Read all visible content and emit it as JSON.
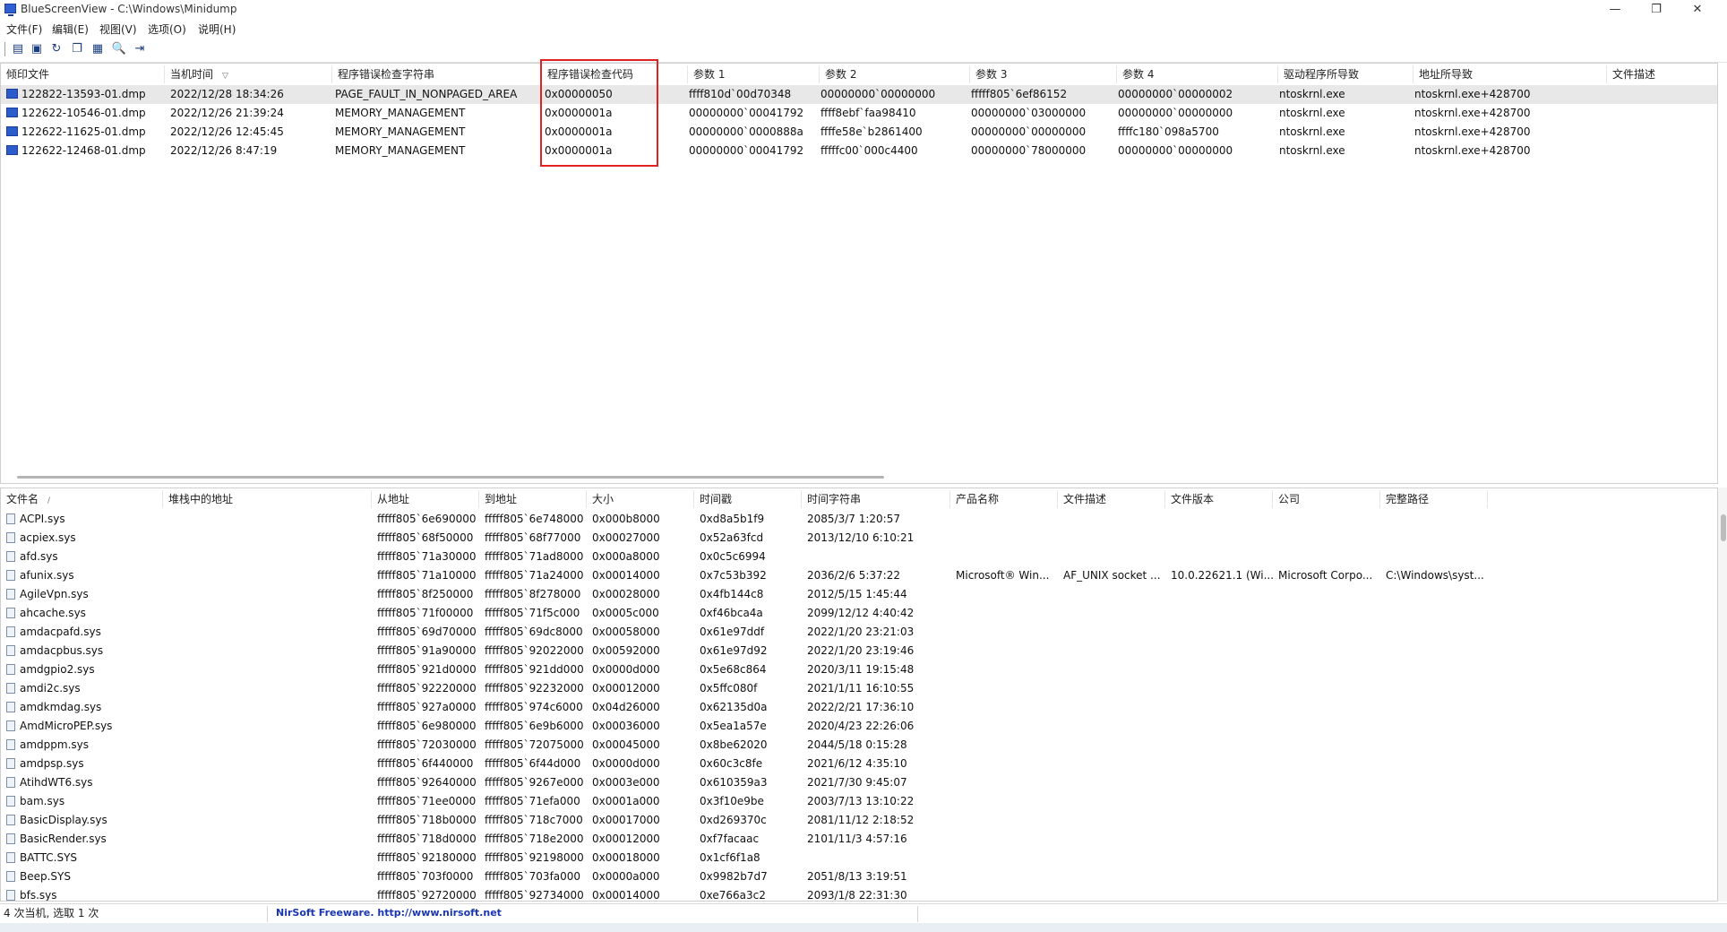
{
  "window": {
    "title": "BlueScreenView  -  C:\\Windows\\Minidump"
  },
  "menu": [
    "文件(F)",
    "编辑(E)",
    "视图(V)",
    "选项(O)",
    "说明(H)"
  ],
  "toolbar": [
    {
      "icon": "properties-icon",
      "glyph": "▤"
    },
    {
      "icon": "save-icon",
      "glyph": "▣"
    },
    {
      "icon": "refresh-icon",
      "glyph": "↻"
    },
    {
      "icon": "copy-icon",
      "glyph": "❐"
    },
    {
      "icon": "report-icon",
      "glyph": "▦"
    },
    {
      "icon": "find-icon",
      "glyph": "🔍"
    },
    {
      "icon": "exit-icon",
      "glyph": "⇥"
    }
  ],
  "top_table": {
    "headers": [
      "倾印文件",
      "当机时间",
      "程序错误检查字符串",
      "程序错误检查代码",
      "参数 1",
      "参数 2",
      "参数 3",
      "参数 4",
      "驱动程序所导致",
      "地址所导致",
      "文件描述"
    ],
    "sort_arrow": "▽",
    "rows": [
      [
        "122822-13593-01.dmp",
        "2022/12/28 18:34:26",
        "PAGE_FAULT_IN_NONPAGED_AREA",
        "0x00000050",
        "ffff810d`00d70348",
        "00000000`00000000",
        "fffff805`6ef86152",
        "00000000`00000002",
        "ntoskrnl.exe",
        "ntoskrnl.exe+428700"
      ],
      [
        "122622-10546-01.dmp",
        "2022/12/26 21:39:24",
        "MEMORY_MANAGEMENT",
        "0x0000001a",
        "00000000`00041792",
        "ffff8ebf`faa98410",
        "00000000`03000000",
        "00000000`00000000",
        "ntoskrnl.exe",
        "ntoskrnl.exe+428700"
      ],
      [
        "122622-11625-01.dmp",
        "2022/12/26 12:45:45",
        "MEMORY_MANAGEMENT",
        "0x0000001a",
        "00000000`0000888a",
        "ffffe58e`b2861400",
        "00000000`00000000",
        "ffffc180`098a5700",
        "ntoskrnl.exe",
        "ntoskrnl.exe+428700"
      ],
      [
        "122622-12468-01.dmp",
        "2022/12/26 8:47:19",
        "MEMORY_MANAGEMENT",
        "0x0000001a",
        "00000000`00041792",
        "fffffc00`000c4400",
        "00000000`78000000",
        "00000000`00000000",
        "ntoskrnl.exe",
        "ntoskrnl.exe+428700"
      ]
    ]
  },
  "bottom_table": {
    "headers": [
      "文件名",
      "堆栈中的地址",
      "从地址",
      "到地址",
      "大小",
      "时间戳",
      "时间字符串",
      "产品名称",
      "文件描述",
      "文件版本",
      "公司",
      "完整路径"
    ],
    "sort_arrow": "/",
    "rows": [
      [
        "ACPI.sys",
        "",
        "fffff805`6e690000",
        "fffff805`6e748000",
        "0x000b8000",
        "0xd8a5b1f9",
        "2085/3/7 1:20:57",
        "",
        "",
        "",
        "",
        ""
      ],
      [
        "acpiex.sys",
        "",
        "fffff805`68f50000",
        "fffff805`68f77000",
        "0x00027000",
        "0x52a63fcd",
        "2013/12/10 6:10:21",
        "",
        "",
        "",
        "",
        ""
      ],
      [
        "afd.sys",
        "",
        "fffff805`71a30000",
        "fffff805`71ad8000",
        "0x000a8000",
        "0x0c5c6994",
        "",
        "",
        "",
        "",
        "",
        ""
      ],
      [
        "afunix.sys",
        "",
        "fffff805`71a10000",
        "fffff805`71a24000",
        "0x00014000",
        "0x7c53b392",
        "2036/2/6 5:37:22",
        "Microsoft® Win...",
        "AF_UNIX socket ...",
        "10.0.22621.1 (Wi...",
        "Microsoft Corpo...",
        "C:\\Windows\\syst..."
      ],
      [
        "AgileVpn.sys",
        "",
        "fffff805`8f250000",
        "fffff805`8f278000",
        "0x00028000",
        "0x4fb144c8",
        "2012/5/15 1:45:44",
        "",
        "",
        "",
        "",
        ""
      ],
      [
        "ahcache.sys",
        "",
        "fffff805`71f00000",
        "fffff805`71f5c000",
        "0x0005c000",
        "0xf46bca4a",
        "2099/12/12 4:40:42",
        "",
        "",
        "",
        "",
        ""
      ],
      [
        "amdacpafd.sys",
        "",
        "fffff805`69d70000",
        "fffff805`69dc8000",
        "0x00058000",
        "0x61e97ddf",
        "2022/1/20 23:21:03",
        "",
        "",
        "",
        "",
        ""
      ],
      [
        "amdacpbus.sys",
        "",
        "fffff805`91a90000",
        "fffff805`92022000",
        "0x00592000",
        "0x61e97d92",
        "2022/1/20 23:19:46",
        "",
        "",
        "",
        "",
        ""
      ],
      [
        "amdgpio2.sys",
        "",
        "fffff805`921d0000",
        "fffff805`921dd000",
        "0x0000d000",
        "0x5e68c864",
        "2020/3/11 19:15:48",
        "",
        "",
        "",
        "",
        ""
      ],
      [
        "amdi2c.sys",
        "",
        "fffff805`92220000",
        "fffff805`92232000",
        "0x00012000",
        "0x5ffc080f",
        "2021/1/11 16:10:55",
        "",
        "",
        "",
        "",
        ""
      ],
      [
        "amdkmdag.sys",
        "",
        "fffff805`927a0000",
        "fffff805`974c6000",
        "0x04d26000",
        "0x62135d0a",
        "2022/2/21 17:36:10",
        "",
        "",
        "",
        "",
        ""
      ],
      [
        "AmdMicroPEP.sys",
        "",
        "fffff805`6e980000",
        "fffff805`6e9b6000",
        "0x00036000",
        "0x5ea1a57e",
        "2020/4/23 22:26:06",
        "",
        "",
        "",
        "",
        ""
      ],
      [
        "amdppm.sys",
        "",
        "fffff805`72030000",
        "fffff805`72075000",
        "0x00045000",
        "0x8be62020",
        "2044/5/18 0:15:28",
        "",
        "",
        "",
        "",
        ""
      ],
      [
        "amdpsp.sys",
        "",
        "fffff805`6f440000",
        "fffff805`6f44d000",
        "0x0000d000",
        "0x60c3c8fe",
        "2021/6/12 4:35:10",
        "",
        "",
        "",
        "",
        ""
      ],
      [
        "AtihdWT6.sys",
        "",
        "fffff805`92640000",
        "fffff805`9267e000",
        "0x0003e000",
        "0x610359a3",
        "2021/7/30 9:45:07",
        "",
        "",
        "",
        "",
        ""
      ],
      [
        "bam.sys",
        "",
        "fffff805`71ee0000",
        "fffff805`71efa000",
        "0x0001a000",
        "0x3f10e9be",
        "2003/7/13 13:10:22",
        "",
        "",
        "",
        "",
        ""
      ],
      [
        "BasicDisplay.sys",
        "",
        "fffff805`718b0000",
        "fffff805`718c7000",
        "0x00017000",
        "0xd269370c",
        "2081/11/12 2:18:52",
        "",
        "",
        "",
        "",
        ""
      ],
      [
        "BasicRender.sys",
        "",
        "fffff805`718d0000",
        "fffff805`718e2000",
        "0x00012000",
        "0xf7facaac",
        "2101/11/3 4:57:16",
        "",
        "",
        "",
        "",
        ""
      ],
      [
        "BATTC.SYS",
        "",
        "fffff805`92180000",
        "fffff805`92198000",
        "0x00018000",
        "0x1cf6f1a8",
        "",
        "",
        "",
        "",
        "",
        ""
      ],
      [
        "Beep.SYS",
        "",
        "fffff805`703f0000",
        "fffff805`703fa000",
        "0x0000a000",
        "0x9982b7d7",
        "2051/8/13 3:19:51",
        "",
        "",
        "",
        "",
        ""
      ],
      [
        "bfs.sys",
        "",
        "fffff805`92720000",
        "fffff805`92734000",
        "0x00014000",
        "0xe766a3c2",
        "2093/1/8 22:31:30",
        "",
        "",
        "",
        "",
        ""
      ]
    ]
  },
  "status": {
    "left": "4 次当机, 选取 1 次",
    "link": "NirSoft Freeware.  http://www.nirsoft.net"
  }
}
